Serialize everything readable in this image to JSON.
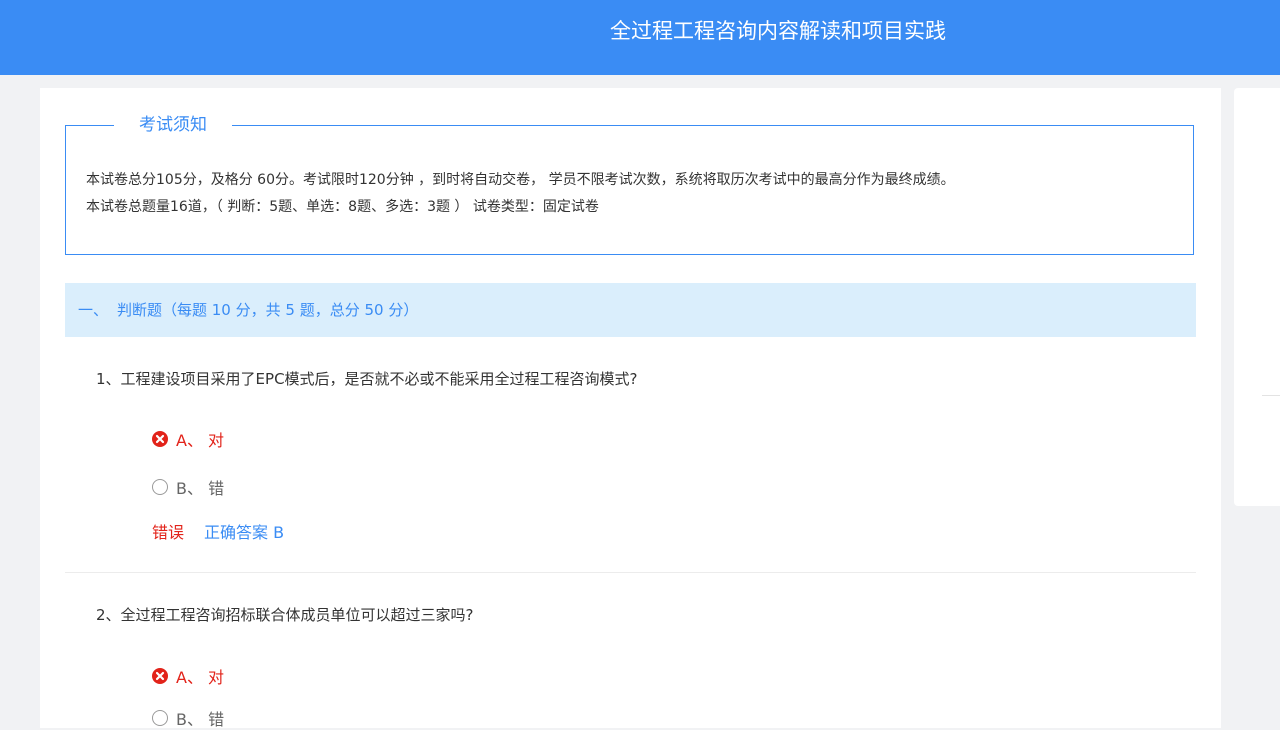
{
  "header": {
    "title": "全过程工程咨询内容解读和项目实践"
  },
  "notice": {
    "legend": "考试须知",
    "line1": "本试卷总分105分，及格分 60分。考试限时120分钟 ，到时将自动交卷， 学员不限考试次数，系统将取历次考试中的最高分作为最终成绩。",
    "line2": "本试卷总题量16道，（ 判断：5题、单选：8题、多选：3题 ）  试卷类型：固定试卷"
  },
  "section": {
    "number": "一、",
    "title": "判断题（每题 10 分，共 5 题，总分 50 分）"
  },
  "questions": [
    {
      "text": "1、工程建设项目采用了EPC模式后，是否就不必或不能采用全过程工程咨询模式?",
      "options": [
        {
          "label": "A、 对",
          "state": "wrong-selected"
        },
        {
          "label": "B、 错",
          "state": "unselected"
        }
      ],
      "result": "错误",
      "answer": "正确答案 B"
    },
    {
      "text": "2、全过程工程咨询招标联合体成员单位可以超过三家吗?",
      "options": [
        {
          "label": "A、 对",
          "state": "wrong-selected"
        },
        {
          "label": "B、 错",
          "state": "unselected"
        }
      ]
    }
  ],
  "colors": {
    "accent": "#3a8cf4",
    "wrong": "#e2231a",
    "section_bg": "#daeefc"
  },
  "icons": {
    "wrong_selected": "x-circle-icon",
    "unselected": "radio-icon"
  }
}
